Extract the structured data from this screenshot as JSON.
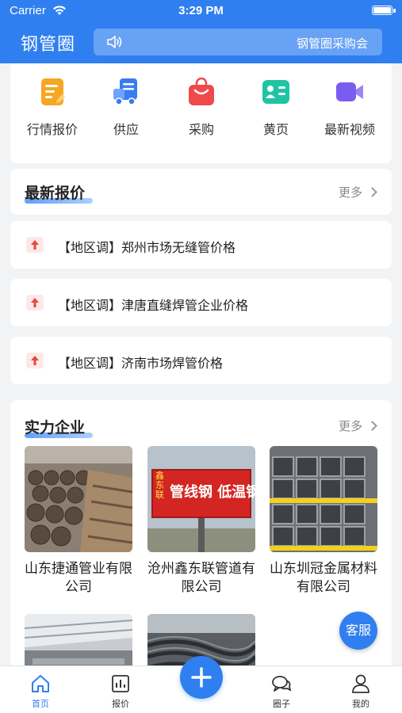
{
  "status_bar": {
    "carrier": "Carrier",
    "time": "3:29 PM"
  },
  "header": {
    "title": "钢管圈",
    "notice": "钢管圈采购会"
  },
  "quick_nav": [
    {
      "label": "行情报价",
      "icon": "quote-icon",
      "color": "#f5a623"
    },
    {
      "label": "供应",
      "icon": "supply-truck-icon",
      "color": "#3a7cf0"
    },
    {
      "label": "采购",
      "icon": "shopping-bag-icon",
      "color": "#f0494c"
    },
    {
      "label": "黄页",
      "icon": "contact-card-icon",
      "color": "#20c4a4"
    },
    {
      "label": "最新视频",
      "icon": "video-camera-icon",
      "color": "#7a5cf0"
    }
  ],
  "latest_prices": {
    "title": "最新报价",
    "more": "更多",
    "items": [
      {
        "text": "【地区调】郑州市场无缝管价格"
      },
      {
        "text": "【地区调】津唐直缝焊管企业价格"
      },
      {
        "text": "【地区调】济南市场焊管价格"
      }
    ]
  },
  "companies": {
    "title": "实力企业",
    "more": "更多",
    "items": [
      {
        "name": "山东捷通管业有限公司"
      },
      {
        "name": "沧州鑫东联管道有限公司",
        "sign_text": "管线钢 低温钢",
        "sign_brand": "鑫东联"
      },
      {
        "name": "山东圳冠金属材料有限公司"
      },
      {
        "name": ""
      },
      {
        "name": ""
      }
    ]
  },
  "kefu": "客服",
  "tabbar": [
    {
      "label": "首页",
      "icon": "home-icon",
      "active": true
    },
    {
      "label": "报价",
      "icon": "chart-icon",
      "active": false
    },
    {
      "label": "圈子",
      "icon": "chat-icon",
      "active": false
    },
    {
      "label": "我的",
      "icon": "user-icon",
      "active": false
    }
  ],
  "colors": {
    "primary": "#2f7ff0",
    "up_arrow": "#e5483f"
  }
}
